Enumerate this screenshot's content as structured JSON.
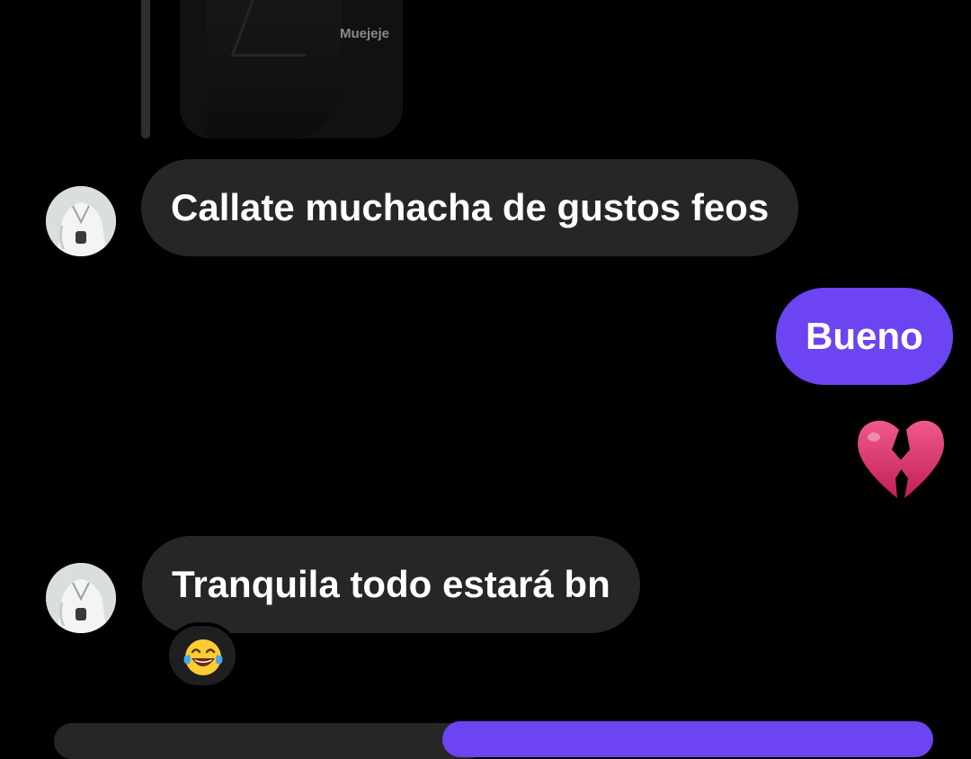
{
  "shared_media": {
    "caption": "Muejeje"
  },
  "messages": [
    {
      "id": "m1",
      "sender": "contact",
      "text": "Callate muchacha de gustos feos"
    },
    {
      "id": "m2",
      "sender": "me",
      "text": "Bueno"
    },
    {
      "id": "m3",
      "sender": "me",
      "emoji": "broken-heart-icon"
    },
    {
      "id": "m4",
      "sender": "contact",
      "text": "Tranquila todo estará bn",
      "reaction": "laughing-tears-icon"
    }
  ],
  "colors": {
    "background": "#000000",
    "incoming_bubble": "#262626",
    "outgoing_bubble": "#6c44f2",
    "text": "#ffffff"
  }
}
